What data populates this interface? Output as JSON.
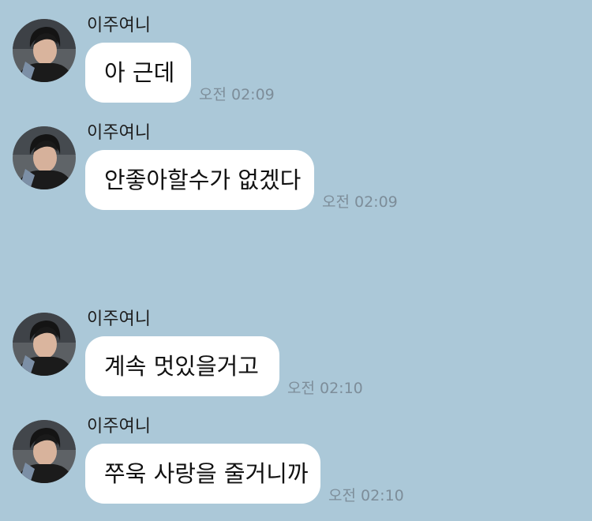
{
  "chat": {
    "background_color": "#abc8d8",
    "messages": [
      {
        "sender": "이주여니",
        "text": "아 근데",
        "time": "오전 02:09"
      },
      {
        "sender": "이주여니",
        "text": "안좋아할수가 없겠다",
        "time": "오전 02:09"
      },
      {
        "sender": "이주여니",
        "text": "계속 멋있을거고",
        "time": "오전 02:10"
      },
      {
        "sender": "이주여니",
        "text": "쭈욱 사랑을 줄거니까",
        "time": "오전 02:10"
      }
    ]
  }
}
